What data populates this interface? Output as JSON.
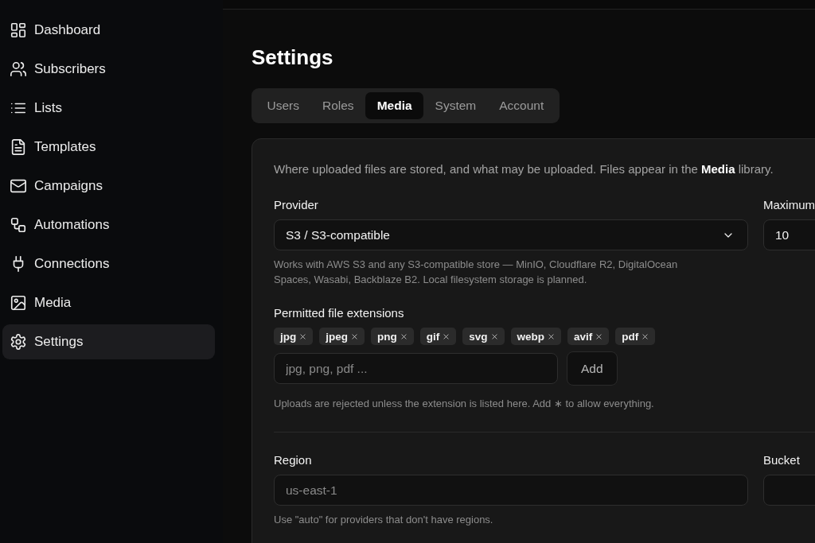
{
  "sidebar": {
    "items": [
      {
        "label": "Dashboard",
        "selected": false
      },
      {
        "label": "Subscribers",
        "selected": false
      },
      {
        "label": "Lists",
        "selected": false
      },
      {
        "label": "Templates",
        "selected": false
      },
      {
        "label": "Campaigns",
        "selected": false
      },
      {
        "label": "Automations",
        "selected": false
      },
      {
        "label": "Connections",
        "selected": false
      },
      {
        "label": "Media",
        "selected": false
      },
      {
        "label": "Settings",
        "selected": true
      }
    ]
  },
  "page": {
    "title": "Settings"
  },
  "tabs": [
    {
      "label": "Users",
      "selected": false
    },
    {
      "label": "Roles",
      "selected": false
    },
    {
      "label": "Media",
      "selected": true
    },
    {
      "label": "System",
      "selected": false
    },
    {
      "label": "Account",
      "selected": false
    }
  ],
  "media_card": {
    "description": "Where uploaded files are stored, and what may be uploaded. Files appear in the **Media** library.",
    "provider": {
      "label": "Provider",
      "value": "S3 / S3-compatible",
      "hint": "Works with AWS S3 and any S3-compatible store — MinIO, Cloudflare R2, DigitalOcean Spaces, Wasabi, Backblaze B2. Local filesystem storage is planned."
    },
    "maximum": {
      "label": "Maximum",
      "value": "10"
    },
    "extensions": {
      "label": "Permitted file extensions",
      "tags": [
        "jpg",
        "jpeg",
        "png",
        "gif",
        "svg",
        "webp",
        "avif",
        "pdf"
      ],
      "input": {
        "placeholder": "jpg, png, pdf ..."
      },
      "add_button": "Add",
      "hint": "Uploads are rejected unless the extension is listed here. Add ∗ to allow everything."
    },
    "region": {
      "label": "Region",
      "placeholder": "us-east-1",
      "hint": "Use \"auto\" for providers that don't have regions."
    },
    "bucket": {
      "label": "Bucket"
    }
  }
}
